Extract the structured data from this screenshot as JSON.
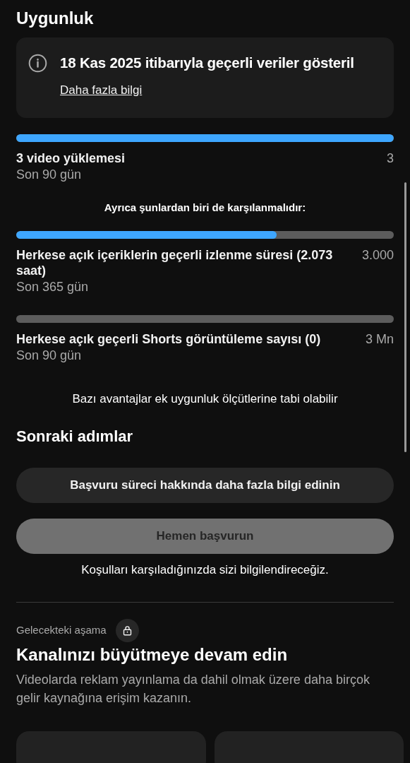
{
  "section_title": "Uygunluk",
  "notice": {
    "text": "18 Kas 2025 itibarıyla geçerli veriler gösteril",
    "link": "Daha fazla bilgi"
  },
  "primary_requirement": {
    "label": "3 video yüklemesi",
    "value": "3",
    "period": "Son 90 gün",
    "level": 1
  },
  "alternatives_heading": "Ayrıca şunlardan biri de karşılanmalıdır:",
  "alternatives": [
    {
      "label": "Herkese açık içeriklerin geçerli izlenme süresi (2.073 saat)",
      "value": "3.000",
      "period": "Son 365 gün",
      "level": 0.69
    },
    {
      "label": "Herkese açık geçerli Shorts görüntüleme sayısı (0)",
      "value": "3 Mn",
      "period": "Son 90 gün",
      "level": 0
    }
  ],
  "footnote": "Bazı avantajlar ek uygunluk ölçütlerine tabi olabilir",
  "next_steps": {
    "title": "Sonraki adımlar",
    "buttons": [
      {
        "label": "Başvuru süreci hakkında daha fazla bilgi edinin",
        "disabled": false
      },
      {
        "label": "Hemen başvurun",
        "disabled": true
      }
    ],
    "note": "Koşulları karşıladığınızda sizi bilgilendireceğiz."
  },
  "future_stage": {
    "eyebrow": "Gelecekteki aşama",
    "locked": true,
    "title": "Kanalınızı büyütmeye devam edin",
    "description": "Videolarda reklam yayınlama da dahil olmak üzere daha birçok gelir kaynağına erişim kazanın."
  }
}
